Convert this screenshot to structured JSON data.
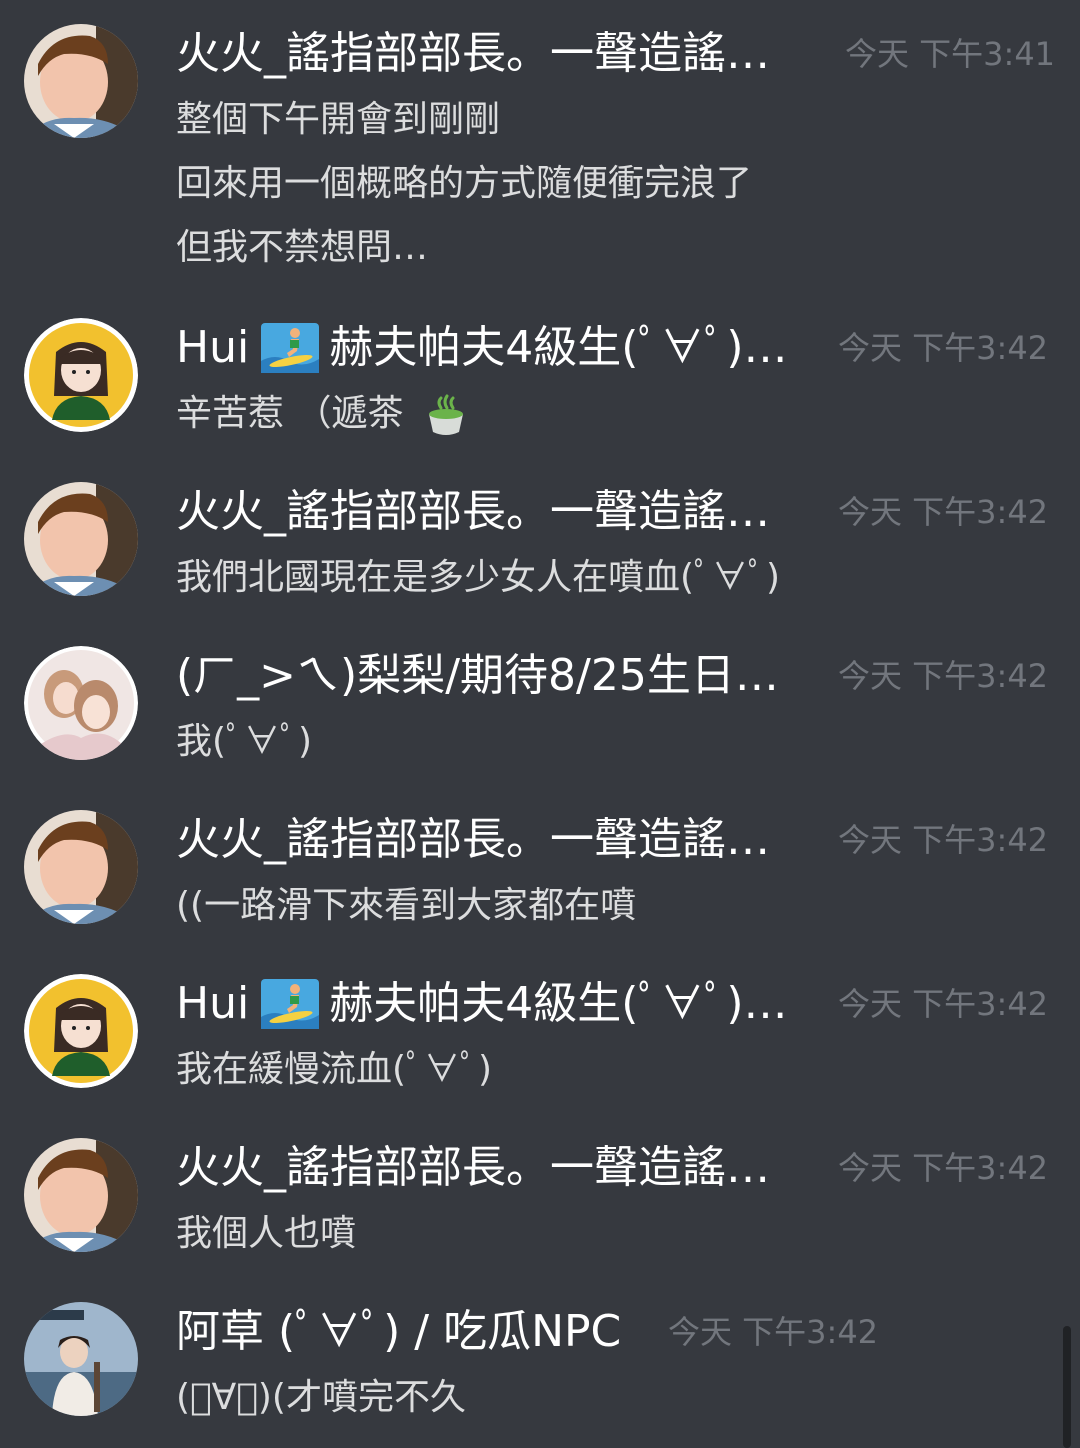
{
  "messages": [
    {
      "username": "火火_謠指部部長。一聲造謠…",
      "timestamp": "今天 下午3:41",
      "lines": [
        "整個下午開會到剛剛",
        "回來用一個概略的方式隨便衝完浪了",
        "但我不禁想問…"
      ]
    },
    {
      "username_prefix": "Hui",
      "username_emoji": "surfer-emoji",
      "username": "赫夫帕夫4級生(ﾟ∀ﾟ)…",
      "timestamp": "今天 下午3:42",
      "lines": [
        "辛苦惹 （遞茶"
      ],
      "line_emoji": "green-tea-emoji"
    },
    {
      "username": "火火_謠指部部長。一聲造謠…",
      "timestamp": "今天 下午3:42",
      "lines": [
        "我們北國現在是多少女人在噴血(ﾟ∀ﾟ)"
      ]
    },
    {
      "username": "(ㄏ_>ㄟ)梨梨/期待8/25生日…",
      "timestamp": "今天 下午3:42",
      "lines": [
        "我(ﾟ∀ﾟ)"
      ]
    },
    {
      "username": "火火_謠指部部長。一聲造謠…",
      "timestamp": "今天 下午3:42",
      "lines": [
        "((一路滑下來看到大家都在噴"
      ]
    },
    {
      "username_prefix": "Hui",
      "username_emoji": "surfer-emoji",
      "username": "赫夫帕夫4級生(ﾟ∀ﾟ)…",
      "timestamp": "今天 下午3:42",
      "lines": [
        "我在緩慢流血(ﾟ∀ﾟ)"
      ]
    },
    {
      "username": "火火_謠指部部長。一聲造謠…",
      "timestamp": "今天 下午3:42",
      "lines": [
        "我個人也噴"
      ]
    },
    {
      "username": "阿草 (ﾟ∀ﾟ) / 吃瓜NPC",
      "timestamp": "今天 下午3:42",
      "lines": [
        "(ﾟ∀ﾟ)(才噴完不久"
      ]
    }
  ],
  "colors": {
    "background": "#36393f",
    "username": "#ffffff",
    "message_text": "#dcddde",
    "timestamp": "#72767d"
  }
}
